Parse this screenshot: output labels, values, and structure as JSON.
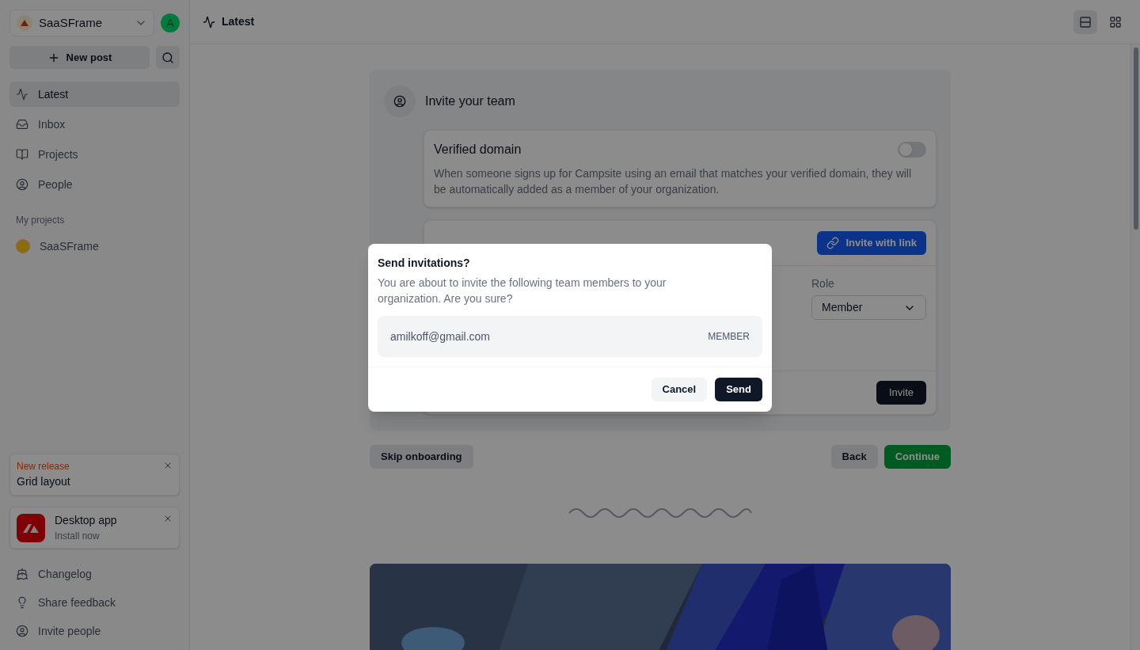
{
  "workspace": {
    "name": "SaaSFrame",
    "avatar": "A"
  },
  "sidebar": {
    "new_post": "New post",
    "nav": [
      {
        "label": "Latest",
        "kind": "activity",
        "selected": true
      },
      {
        "label": "Inbox",
        "kind": "inbox",
        "selected": false
      },
      {
        "label": "Projects",
        "kind": "book",
        "selected": false
      },
      {
        "label": "People",
        "kind": "user",
        "selected": false
      }
    ],
    "projects_heading": "My projects",
    "projects": [
      {
        "label": "SaaSFrame",
        "selected": false
      }
    ],
    "release_card": {
      "tag": "New release",
      "title": "Grid layout"
    },
    "app_card": {
      "title": "Desktop app",
      "subtitle": "Install now"
    },
    "footer": [
      {
        "label": "Changelog",
        "kind": "ship"
      },
      {
        "label": "Share feedback",
        "kind": "bulb"
      },
      {
        "label": "Invite people",
        "kind": "user"
      }
    ]
  },
  "header": {
    "title": "Latest",
    "views": [
      {
        "kind": "list",
        "selected": true
      },
      {
        "kind": "grid",
        "selected": false
      }
    ]
  },
  "onboarding": {
    "title": "Invite your team",
    "verified_domain": {
      "title": "Verified domain",
      "on": false,
      "text": "When someone signs up for Campsite using an email that matches your verified domain, they will be automatically added as a member of your organization."
    },
    "invite": {
      "link_button": "Invite with link",
      "role_label": "Role",
      "role_value": "Member",
      "invite_button": "Invite"
    },
    "skip": "Skip onboarding",
    "back": "Back",
    "continue": "Continue"
  },
  "dialog": {
    "title": "Send invitations?",
    "text": "You are about to invite the following team members to your organization. Are you sure?",
    "invitees": [
      {
        "email": "amilkoff@gmail.com",
        "role": "MEMBER"
      }
    ],
    "cancel": "Cancel",
    "send": "Send"
  }
}
